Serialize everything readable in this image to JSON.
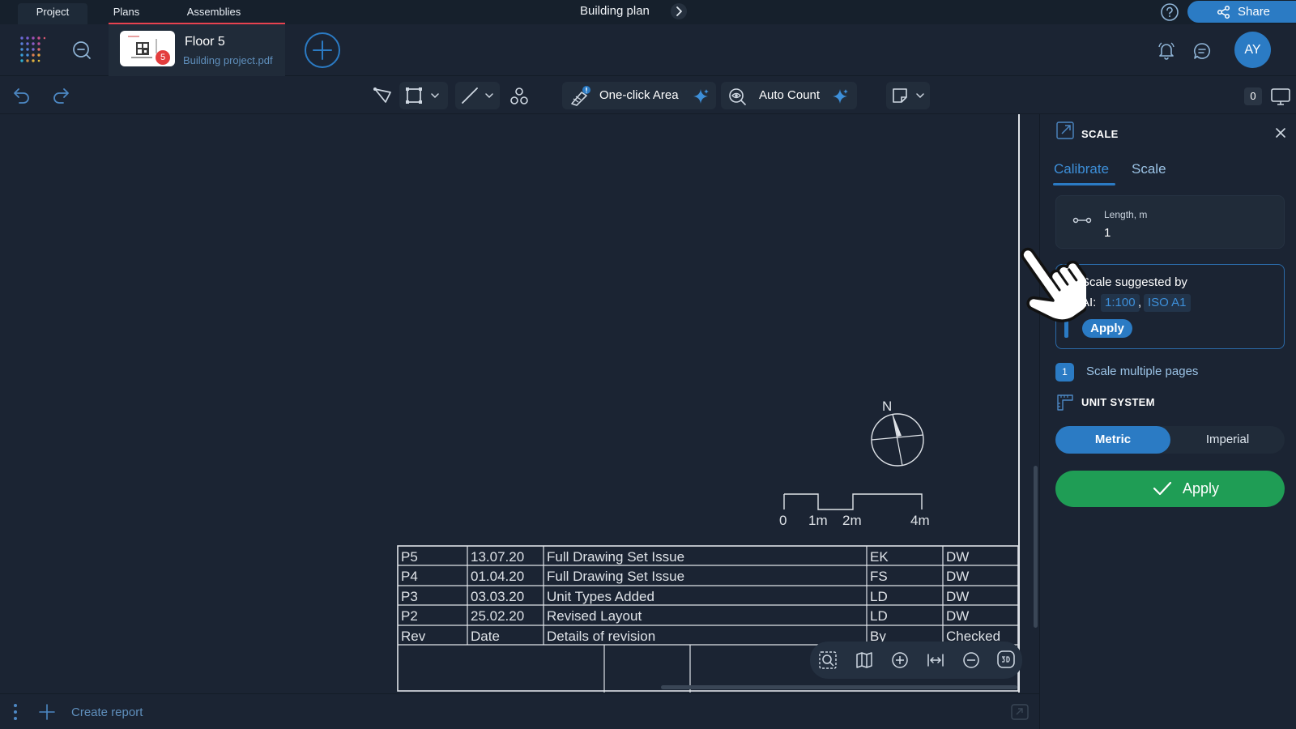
{
  "top_tabs": {
    "project": "Project",
    "plans": "Plans",
    "assemblies": "Assemblies"
  },
  "title": "Building plan",
  "share_label": "Share",
  "plan": {
    "name": "Floor 5",
    "file": "Building project.pdf",
    "badge": "5"
  },
  "user": {
    "initials": "AY"
  },
  "toolbar": {
    "one_click_area": "One-click Area",
    "auto_count": "Auto Count",
    "counter": "0"
  },
  "drawing": {
    "north_label": "N",
    "scale_bar_labels": [
      "0",
      "1m",
      "2m",
      "4m"
    ],
    "revisions": {
      "rows": [
        [
          "P5",
          "13.07.20",
          "Full Drawing Set Issue",
          "EK",
          "DW"
        ],
        [
          "P4",
          "01.04.20",
          "Full Drawing Set Issue",
          "FS",
          "DW"
        ],
        [
          "P3",
          "03.03.20",
          "Unit Types Added",
          "LD",
          "DW"
        ],
        [
          "P2",
          "25.02.20",
          "Revised Layout",
          "LD",
          "DW"
        ]
      ],
      "header": [
        "Rev",
        "Date",
        "Details of revision",
        "By",
        "Checked"
      ]
    }
  },
  "bottom": {
    "create_report": "Create report"
  },
  "panel": {
    "title": "SCALE",
    "tabs": {
      "calibrate": "Calibrate",
      "scale": "Scale"
    },
    "length": {
      "label": "Length, m",
      "value": "1"
    },
    "suggestion": {
      "title": "Scale suggested by",
      "prefix": "AI:",
      "options": [
        "1:100",
        "ISO A1"
      ],
      "apply": "Apply"
    },
    "multi_pages": {
      "count": "1",
      "label": "Scale multiple pages"
    },
    "unit_system": {
      "title": "UNIT SYSTEM",
      "metric": "Metric",
      "imperial": "Imperial",
      "selected": "Metric"
    },
    "apply_label": "Apply"
  },
  "colors": {
    "accent": "#2b7bc4",
    "apply_green": "#1f9d55",
    "plans_underline": "#e8424f",
    "background": "#1b2433"
  }
}
